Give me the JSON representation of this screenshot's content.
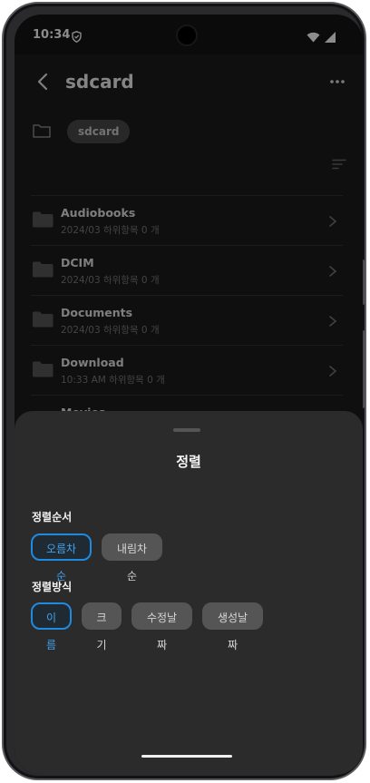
{
  "colors": {
    "screen_bg": "#1c1c1c",
    "sheet_bg": "#2b2b2b",
    "chip_bg": "#555555",
    "selected_accent": "#1e8ae0",
    "selected_text": "#43a3ee"
  },
  "status_bar": {
    "time": "10:34",
    "icons": [
      "shield-icon",
      "wifi-icon",
      "signal-icon"
    ]
  },
  "app_bar": {
    "title": "sdcard",
    "back_icon": "chevron-left-icon",
    "more_icon": "more-horizontal-icon"
  },
  "path": {
    "icon": "folder-outline-icon",
    "chip": "sdcard"
  },
  "sort_icon": "sort-lines-icon",
  "files": [
    {
      "name": "Audiobooks",
      "meta": "2024/03 하위항목 0 개"
    },
    {
      "name": "DCIM",
      "meta": "2024/03 하위항목 0 개"
    },
    {
      "name": "Documents",
      "meta": "2024/03 하위항목 0 개"
    },
    {
      "name": "Download",
      "meta": "10:33 AM 하위항목 0 개"
    },
    {
      "name": "Movies",
      "meta": ""
    }
  ],
  "sort_sheet": {
    "title": "정렬",
    "order_label": "정렬순서",
    "order_options": [
      "오름차순",
      "내림차순"
    ],
    "order_selected": "오름차순",
    "method_label": "정렬방식",
    "method_options": [
      "이름",
      "크기",
      "수정날짜",
      "생성날짜"
    ],
    "method_selected": "이름"
  }
}
